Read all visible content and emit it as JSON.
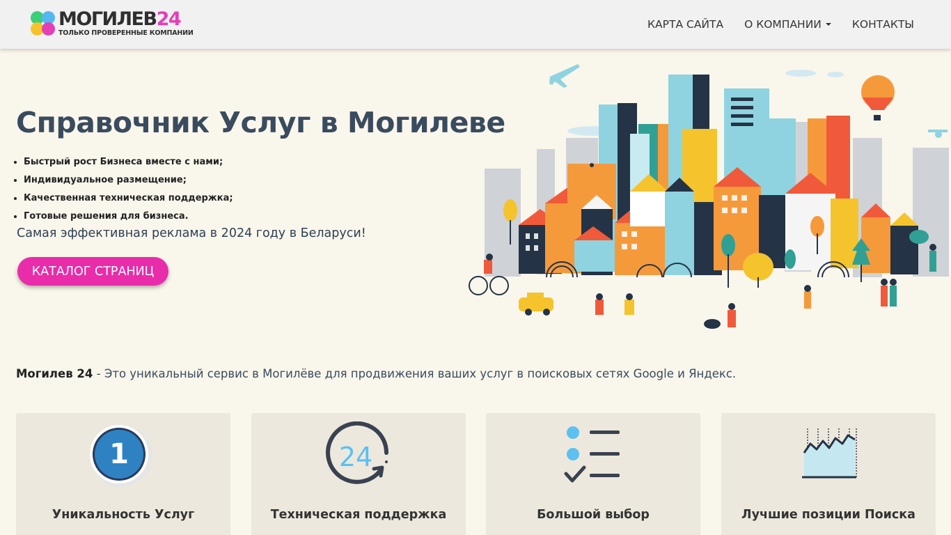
{
  "brand": {
    "name": "МОГИЛЕВ",
    "number": "24",
    "slogan": "ТОЛЬКО ПРОВЕРЕННЫЕ КОМПАНИИ",
    "colors": {
      "green": "#3ccf7a",
      "blue": "#55b6f0",
      "yellow": "#f5c42c",
      "magenta": "#e43fb6"
    }
  },
  "nav": {
    "items": [
      {
        "label": "КАРТА САЙТА"
      },
      {
        "label": "О КОМПАНИИ",
        "dropdown": true
      },
      {
        "label": "КОНТАКТЫ"
      }
    ]
  },
  "hero": {
    "title": "Справочник Услуг в Могилеве",
    "bullets": [
      "Быстрый рост Бизнеса вместе с нами;",
      "Индивидуальное размещение;",
      "Качественная техническая поддержка;",
      "Готовые решения для бизнеса."
    ],
    "tagline": "Самая эффективная реклама в 2024 году в Беларуси!",
    "cta_label": "КАТАЛОГ СТРАНИЦ",
    "cta_color": "#e92ca9",
    "illustration": "city-illustration"
  },
  "intro": {
    "brand": "Могилев 24",
    "text": " - Это уникальный сервис в Могилёве для продвижения ваших услуг в поисковых сетях Google и Яндекс."
  },
  "features": [
    {
      "title": "Уникальность Услуг",
      "icon": "number-one-badge-icon",
      "badge": "1"
    },
    {
      "title": "Техническая поддержка",
      "icon": "24-hours-icon",
      "badge": "24"
    },
    {
      "title": "Большой выбор",
      "icon": "checklist-icon"
    },
    {
      "title": "Лучшие позиции Поиска",
      "icon": "line-chart-icon"
    }
  ]
}
